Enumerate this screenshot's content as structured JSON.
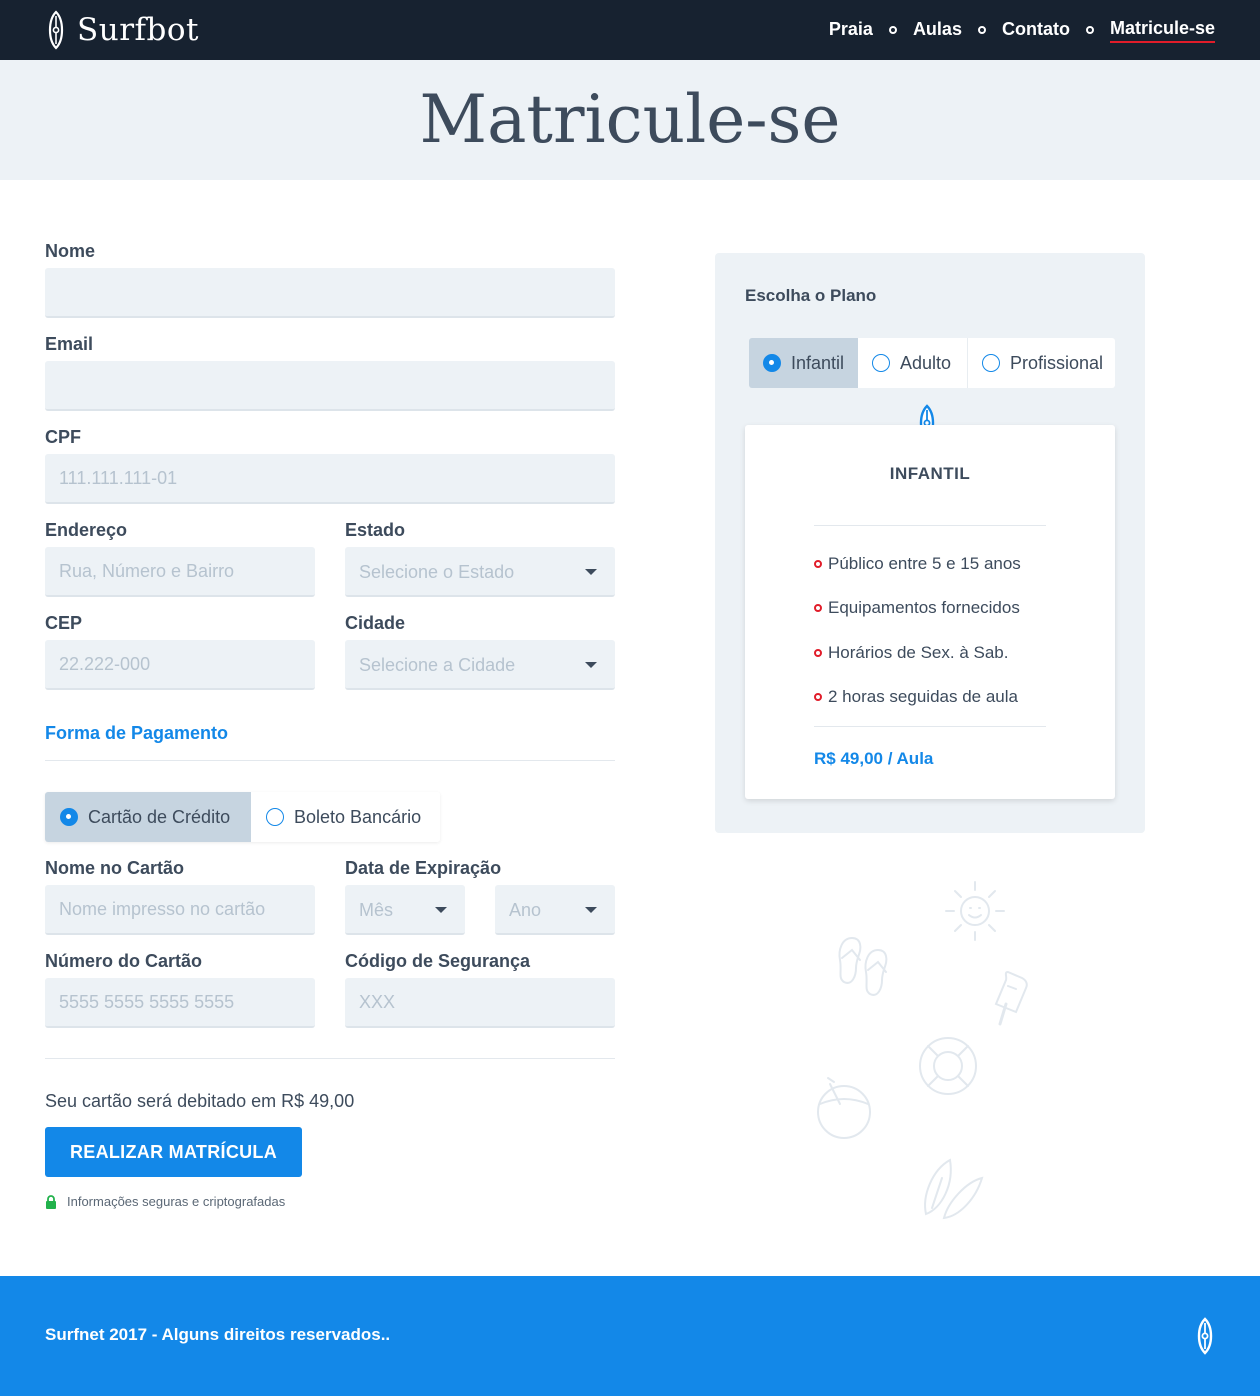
{
  "header": {
    "brand": "Surfbot",
    "nav": [
      "Praia",
      "Aulas",
      "Contato",
      "Matricule-se"
    ]
  },
  "hero": {
    "title": "Matricule-se"
  },
  "form": {
    "nome_label": "Nome",
    "email_label": "Email",
    "cpf_label": "CPF",
    "cpf_placeholder": "111.111.111-01",
    "endereco_label": "Endereço",
    "endereco_placeholder": "Rua, Número e Bairro",
    "estado_label": "Estado",
    "estado_placeholder": "Selecione o Estado",
    "cep_label": "CEP",
    "cep_placeholder": "22.222-000",
    "cidade_label": "Cidade",
    "cidade_placeholder": "Selecione a Cidade",
    "payment_title": "Forma de Pagamento",
    "payment_options": [
      "Cartão de Crédito",
      "Boleto Bancário"
    ],
    "card_name_label": "Nome no Cartão",
    "card_name_placeholder": "Nome impresso no cartão",
    "expiry_label": "Data de Expiração",
    "month_placeholder": "Mês",
    "year_placeholder": "Ano",
    "card_number_label": "Número do Cartão",
    "card_number_placeholder": "5555 5555 5555 5555",
    "cvv_label": "Código de Segurança",
    "cvv_placeholder": "XXX",
    "debit_text": "Seu cartão será debitado em R$ 49,00",
    "submit_label": "REALIZAR MATRÍCULA",
    "secure_text": "Informações seguras e criptografadas"
  },
  "plan": {
    "title": "Escolha o Plano",
    "options": [
      "Infantil",
      "Adulto",
      "Profissional"
    ],
    "selected_name": "INFANTIL",
    "features": [
      "Público entre 5 e 15 anos",
      "Equipamentos fornecidos",
      "Horários de Sex. à Sab.",
      "2 horas seguidas de aula"
    ],
    "price": "R$ 49,00 / Aula"
  },
  "footer": {
    "text": "Surfnet 2017 - Alguns direitos reservados.."
  },
  "colors": {
    "dark": "#172230",
    "accent": "#1388e8",
    "red": "#e11d2a",
    "light": "#edf2f6"
  },
  "icons": [
    "surfboard-logo-icon",
    "caret-down-icon",
    "lock-icon",
    "sun-icon",
    "flip-flops-icon",
    "popsicle-icon",
    "life-ring-icon",
    "coconut-icon",
    "surfboards-icon"
  ]
}
